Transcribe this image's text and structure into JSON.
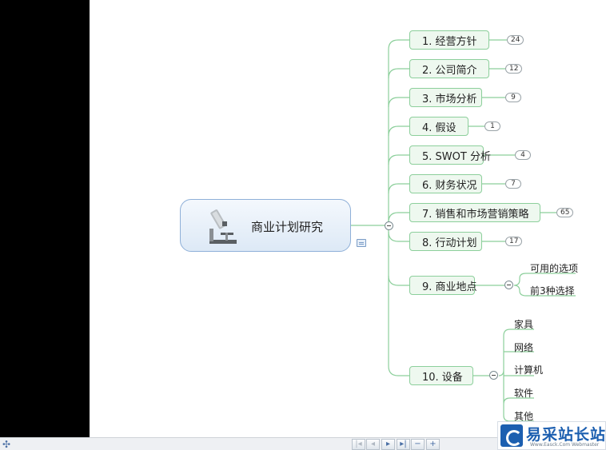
{
  "central_topic": {
    "title": "商业计划研究",
    "icon": "microscope-icon"
  },
  "branches": [
    {
      "label": "1. 经营方针",
      "count": "24"
    },
    {
      "label": "2. 公司简介",
      "count": "12"
    },
    {
      "label": "3. 市场分析",
      "count": "9"
    },
    {
      "label": "4. 假设",
      "count": "1"
    },
    {
      "label": "5. SWOT 分析",
      "count": "4"
    },
    {
      "label": "6. 财务状况",
      "count": "7"
    },
    {
      "label": "7. 销售和市场营销策略",
      "count": "65"
    },
    {
      "label": "8. 行动计划",
      "count": "17"
    },
    {
      "label": "9. 商业地点",
      "children": [
        "可用的选项",
        "前3种选择"
      ]
    },
    {
      "label": "10. 设备",
      "children": [
        "家具",
        "网络",
        "计算机",
        "软件",
        "其他"
      ]
    }
  ],
  "statusbar": {
    "nav_buttons": [
      "first-page",
      "previous-page",
      "next-page",
      "last-page",
      "zoom-out",
      "zoom-in"
    ]
  },
  "watermark": {
    "brand": "易采站长站",
    "tagline": "Www.Easck.Com Webmaster"
  },
  "colors": {
    "branch_border": "#8ccf9b",
    "branch_fill": "#eef8ef",
    "central_border": "#8fb0d8",
    "connector": "#8ccf9b"
  }
}
